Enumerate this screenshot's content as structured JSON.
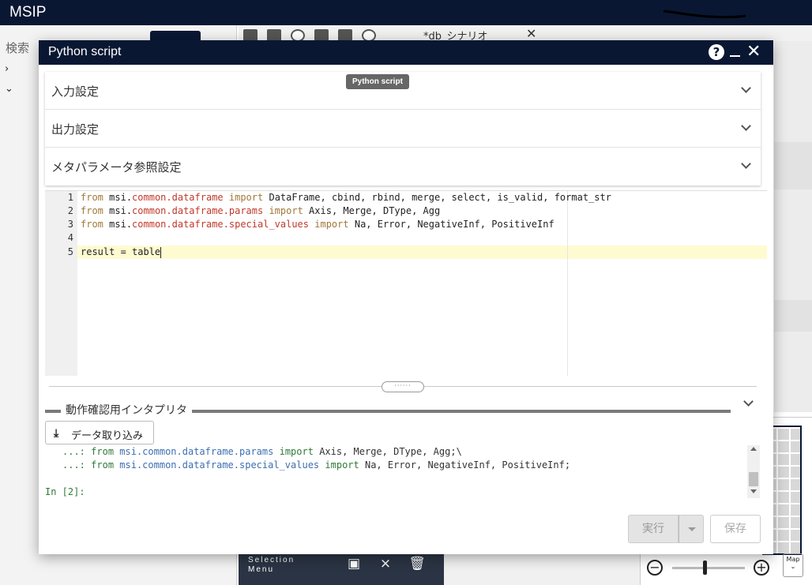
{
  "app": {
    "title": "MSIP"
  },
  "left_panel": {
    "search_label": "検索"
  },
  "background": {
    "tab_title": "*db_シナリオ",
    "selection_menu": {
      "label_line1": "Selection",
      "label_line2": "Menu"
    },
    "minimap": {
      "map_label": "Map",
      "zoom_level": 0.45
    }
  },
  "dialog": {
    "title": "Python script",
    "tooltip": "Python script",
    "accordion": [
      {
        "label": "入力設定"
      },
      {
        "label": "出力設定"
      },
      {
        "label": "メタパラメータ参照設定"
      }
    ],
    "editor": {
      "line_numbers": [
        "1",
        "2",
        "3",
        "4",
        "5"
      ],
      "lines": [
        {
          "kw1": "from",
          "pkg": "msi.",
          "mod": "common.dataframe",
          "kw2": "import",
          "rest": "DataFrame, cbind, rbind, merge, select, is_valid, format_str"
        },
        {
          "kw1": "from",
          "pkg": "msi.",
          "mod": "common.dataframe.params",
          "kw2": "import",
          "rest": "Axis, Merge, DType, Agg"
        },
        {
          "kw1": "from",
          "pkg": "msi.",
          "mod": "common.dataframe.special_values",
          "kw2": "import",
          "rest": "Na, Error, NegativeInf, PositiveInf"
        },
        {
          "text": ""
        },
        {
          "text": "result = table"
        }
      ]
    },
    "interpreter": {
      "title": "動作確認用インタプリタ",
      "import_button": "データ取り込み",
      "console": [
        {
          "prefix": "...:",
          "kw1": "from",
          "mod": "msi.common.dataframe.params",
          "kw2": "import",
          "rest": "Axis, Merge, DType, Agg;\\"
        },
        {
          "prefix": "...:",
          "kw1": "from",
          "mod": "msi.common.dataframe.special_values",
          "kw2": "import",
          "rest": "Na, Error, NegativeInf, PositiveInf;"
        }
      ],
      "prompt": "In [2]:"
    },
    "buttons": {
      "run": "実行",
      "save": "保存"
    }
  }
}
